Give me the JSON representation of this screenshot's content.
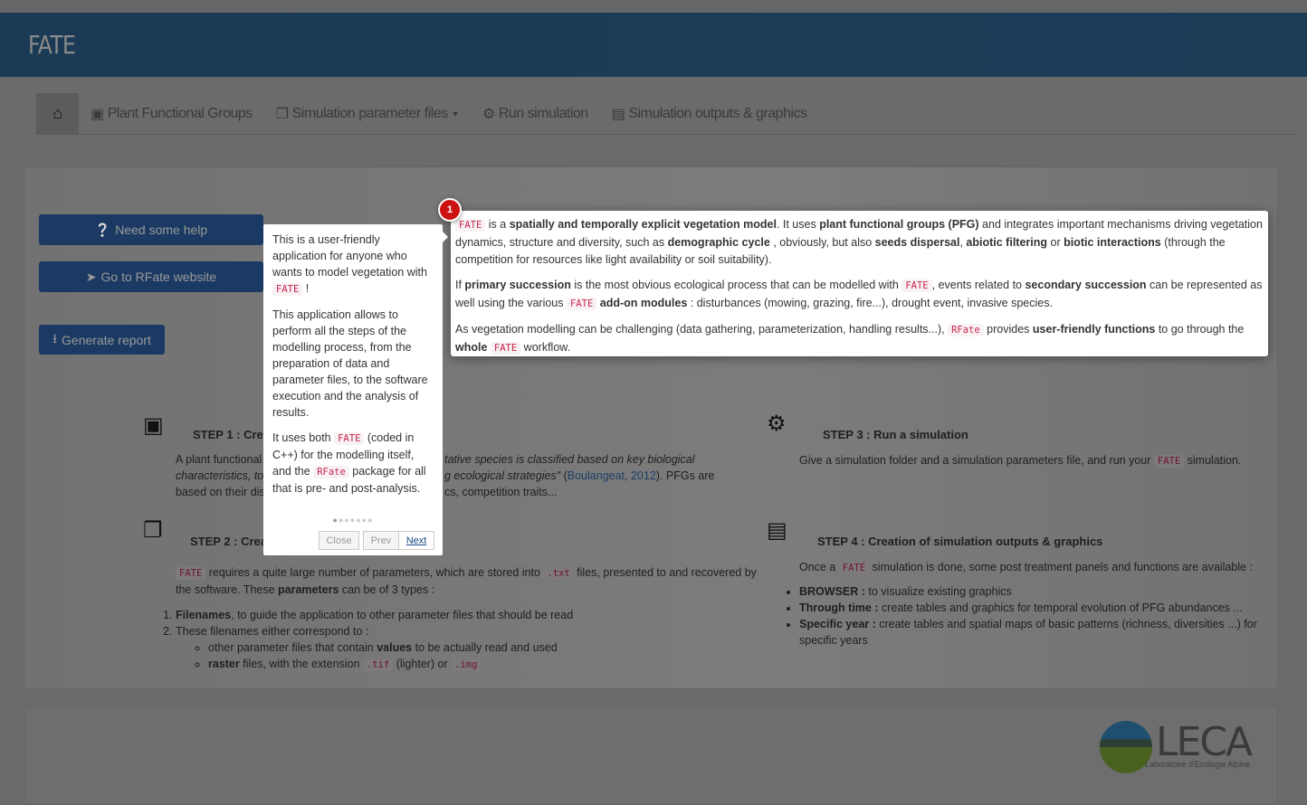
{
  "app": {
    "title": "FATE"
  },
  "nav": {
    "items": [
      {
        "label": "",
        "icon": "home-icon"
      },
      {
        "label": "Plant Functional Groups",
        "icon": "object-group-icon"
      },
      {
        "label": "Simulation parameter files",
        "icon": "files-icon",
        "dropdown": true
      },
      {
        "label": "Run simulation",
        "icon": "gears-icon"
      },
      {
        "label": "Simulation outputs & graphics",
        "icon": "bar-chart-icon"
      }
    ]
  },
  "buttons": {
    "help": "Need some help",
    "website": "Go to RFate website",
    "report": "Generate report"
  },
  "intro": {
    "p1": {
      "code": "FATE",
      "t1": " is a ",
      "b1": "spatially and temporally explicit vegetation model",
      "t2": ". It uses ",
      "b2": "plant functional groups (PFG)",
      "t3": " and integrates important mechanisms driving vegetation dynamics, structure and diversity, such as ",
      "b3": "demographic cycle",
      "t4": " , obviously, but also ",
      "b4": "seeds dispersal",
      "t5": ", ",
      "b5": "abiotic filtering",
      "t6": " or ",
      "b6": "biotic interactions",
      "t7": " (through the competition for resources like light availability or soil suitability)."
    },
    "p2": {
      "t1": "If ",
      "b1": "primary succession",
      "t2": " is the most obvious ecological process that can be modelled with ",
      "code1": "FATE",
      "t3": ", events related to ",
      "b2": "secondary succession",
      "t4": " can be represented as well using the various ",
      "code2": "FATE",
      "b3": "add-on modules",
      "t5": " : disturbances (mowing, grazing, fire...), drought event, invasive species."
    },
    "p3": {
      "t1": "As vegetation modelling can be challenging (data gathering, parameterization, handling results...), ",
      "code1": "RFate",
      "t2": " provides ",
      "b1": "user-friendly functions",
      "t3": " to go through the ",
      "b2": "whole",
      "code2": "FATE",
      "t4": " workflow."
    }
  },
  "steps": {
    "s1": {
      "title": "STEP 1 : Crea",
      "l1a": "A plant functional",
      "l1b": "tative species is classified based on key biological",
      "l2a": "characteristics, to",
      "l2b": "g ecological strategies\"",
      "link": "Boulangeat, 2012",
      "l2c": "). PFGs are",
      "l3a": "based on their dis",
      "l3b": "cs, competition traits..."
    },
    "s2": {
      "title": "STEP 2 : Crea",
      "code1": "FATE",
      "t1": " requires a quite large number of parameters, which are stored into ",
      "code2": ".txt",
      "t2": " files, presented to and recovered by the software. These ",
      "b1": "parameters",
      "t3": " can be of 3 types :",
      "li1b": "Filenames",
      "li1": ", to guide the application to other parameter files that should be read",
      "li2": "These filenames either correspond to :",
      "sub1a": "other parameter files that contain ",
      "sub1b": "values",
      "sub1c": " to be actually read and used",
      "sub2b": "raster",
      "sub2a": " files, with the extension ",
      "code3": ".tif",
      "sub2c": " (lighter) or ",
      "code4": ".img"
    },
    "s3": {
      "title": "STEP 3 : Run a simulation",
      "t1": "Give a simulation folder and a simulation parameters file, and run your ",
      "code": "FATE",
      "t2": " simulation."
    },
    "s4": {
      "title": "STEP 4 : Creation of simulation outputs & graphics",
      "t1": "Once a ",
      "code": "FATE",
      "t2": " simulation is done, some post treatment panels and functions are available :",
      "li1b": "BROWSER :",
      "li1": " to visualize existing graphics",
      "li2b": "Through time :",
      "li2": " create tables and graphics for temporal evolution of PFG abundances ...",
      "li3b": "Specific year :",
      "li3": " create tables and spatial maps of basic patterns (richness, diversities ...) for specific years"
    }
  },
  "tour": {
    "step_badge": "1",
    "p1a": "This is a user-friendly application for anyone who wants to model vegetation with ",
    "p1code": "FATE",
    "p1b": " !",
    "p2": "This application allows to perform all the steps of the modelling process, from the preparation of data and parameter files, to the software execution and the analysis of results.",
    "p3a": "It uses both ",
    "p3code1": "FATE",
    "p3b": " (coded in C++) for the modelling itself, and the ",
    "p3code2": "RFate",
    "p3c": " package for all that is pre- and post-analysis.",
    "current_step": 1,
    "total_steps": 7,
    "close": "Close",
    "prev": "Prev",
    "next": "Next"
  },
  "footer": {
    "logo_text": "LECA",
    "logo_sub": "Laboratoire d'Ecologie Alpine"
  }
}
